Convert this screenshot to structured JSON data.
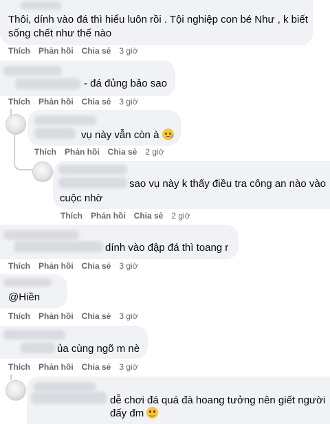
{
  "actions": {
    "like": "Thích",
    "reply": "Phản hồi",
    "share": "Chia sẻ"
  },
  "comments": [
    {
      "line1": "Thôi, dính vào đá thì hiểu luôn rồi . Tội nghiệp con bé Như , k biết",
      "line2": "sống chết như thế nào",
      "time": "3 giờ"
    },
    {
      "text": "- đá đủng bảo sao",
      "time": "3 giờ"
    },
    {
      "text": "vụ này vẫn còn à",
      "emoji": "crying-face",
      "time": "2 giờ"
    },
    {
      "line1": "sao vụ này k thấy điều tra công an nào vào",
      "line2": "cuộc nhờ",
      "time": "2 giờ"
    },
    {
      "text": "dính vào đập đá thì toang r",
      "time": "3 giờ"
    },
    {
      "text": "@Hiền",
      "time": "3 giờ"
    },
    {
      "text": "ủa cùng ngõ m nè",
      "time": "3 giờ"
    },
    {
      "line1": "dễ chơi đá quá đà hoang tưởng nên giết người",
      "line2": "đấy đm",
      "emoji": "smiling-face"
    }
  ]
}
